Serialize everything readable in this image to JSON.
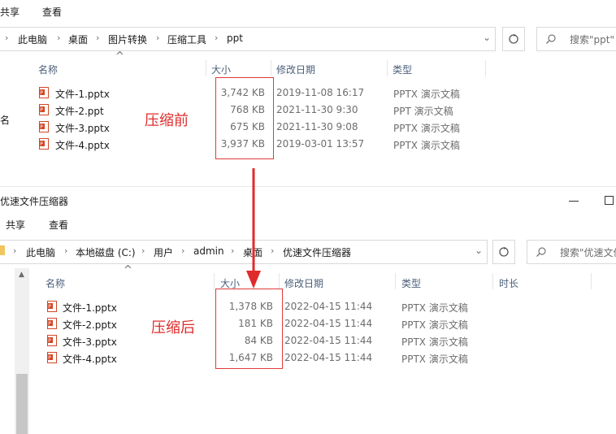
{
  "top": {
    "ribbon": {
      "share": "共享",
      "view": "查看"
    },
    "breadcrumb": [
      "此电脑",
      "桌面",
      "图片转换",
      "压缩工具",
      "ppt"
    ],
    "search_placeholder": "搜索\"ppt\"",
    "left_cut": "名",
    "columns": {
      "name": "名称",
      "size": "大小",
      "date": "修改日期",
      "type": "类型"
    },
    "files": [
      {
        "name": "文件-1.pptx",
        "size": "3,742 KB",
        "date": "2019-11-08 16:17",
        "type": "PPTX 演示文稿"
      },
      {
        "name": "文件-2.ppt",
        "size": "768 KB",
        "date": "2021-11-30 9:30",
        "type": "PPT 演示文稿"
      },
      {
        "name": "文件-3.pptx",
        "size": "675 KB",
        "date": "2021-11-30 9:08",
        "type": "PPTX 演示文稿"
      },
      {
        "name": "文件-4.pptx",
        "size": "3,937 KB",
        "date": "2019-03-01 13:57",
        "type": "PPTX 演示文稿"
      }
    ],
    "annotation": "压缩前"
  },
  "bottom": {
    "title": "优速文件压缩器",
    "ribbon": {
      "share": "共享",
      "view": "查看"
    },
    "breadcrumb": [
      "此电脑",
      "本地磁盘 (C:)",
      "用户",
      "admin",
      "桌面",
      "优速文件压缩器"
    ],
    "search_placeholder": "搜索\"优速文件",
    "columns": {
      "name": "名称",
      "size": "大小",
      "date": "修改日期",
      "type": "类型",
      "length": "时长"
    },
    "files": [
      {
        "name": "文件-1.pptx",
        "size": "1,378 KB",
        "date": "2022-04-15 11:44",
        "type": "PPTX 演示文稿"
      },
      {
        "name": "文件-2.pptx",
        "size": "181 KB",
        "date": "2022-04-15 11:44",
        "type": "PPTX 演示文稿"
      },
      {
        "name": "文件-3.pptx",
        "size": "84 KB",
        "date": "2022-04-15 11:44",
        "type": "PPTX 演示文稿"
      },
      {
        "name": "文件-4.pptx",
        "size": "1,647 KB",
        "date": "2022-04-15 11:44",
        "type": "PPTX 演示文稿"
      }
    ],
    "annotation": "压缩后"
  },
  "colors": {
    "accent_red": "#e02b2b",
    "header_text": "#4c607a",
    "ppt_icon": "#d24726"
  }
}
